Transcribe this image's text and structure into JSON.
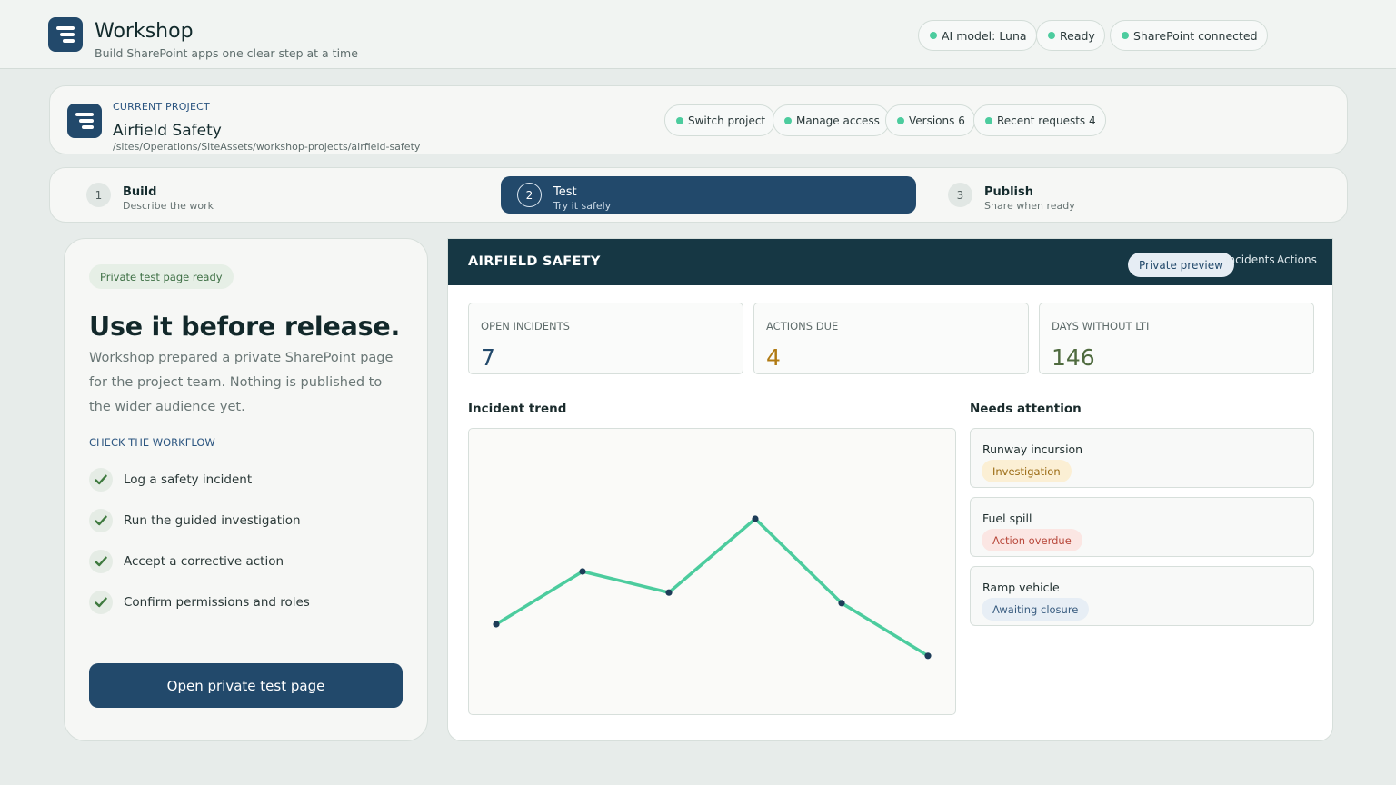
{
  "header": {
    "app_title": "Workshop",
    "app_subtitle": "Build SharePoint apps one clear step at a time",
    "status": [
      {
        "label": "AI model: Luna"
      },
      {
        "label": "Ready"
      },
      {
        "label": "SharePoint connected"
      }
    ]
  },
  "project": {
    "label": "CURRENT PROJECT",
    "name": "Airfield Safety",
    "path": "/sites/Operations/SiteAssets/workshop-projects/airfield-safety",
    "actions": [
      {
        "label": "Switch project"
      },
      {
        "label": "Manage access"
      },
      {
        "label": "Versions 6"
      },
      {
        "label": "Recent requests 4"
      }
    ]
  },
  "steps": [
    {
      "number": "1",
      "title": "Build",
      "desc": "Describe the work"
    },
    {
      "number": "2",
      "title": "Test",
      "desc": "Try it safely"
    },
    {
      "number": "3",
      "title": "Publish",
      "desc": "Share when ready"
    }
  ],
  "test_panel": {
    "badge": "Private test page ready",
    "headline": "Use it before release.",
    "description": "Workshop prepared a private SharePoint page for the project team. Nothing is published to the wider audience yet.",
    "checklist_label": "CHECK THE WORKFLOW",
    "checklist": [
      "Log a safety incident",
      "Run the guided investigation",
      "Accept a corrective action",
      "Confirm permissions and roles"
    ],
    "open_button": "Open private test page"
  },
  "preview": {
    "title": "AIRFIELD SAFETY",
    "badge": "Private preview",
    "tabs": [
      "Incidents",
      "Actions"
    ],
    "kpis": [
      {
        "label": "OPEN INCIDENTS",
        "value": "7",
        "color": "#22496b"
      },
      {
        "label": "ACTIONS DUE",
        "value": "4",
        "color": "#b07a12"
      },
      {
        "label": "DAYS WITHOUT LTI",
        "value": "146",
        "color": "#4f6b3f"
      }
    ],
    "trend_label": "Incident trend",
    "attention_label": "Needs attention",
    "attention": [
      {
        "title": "Runway incursion",
        "tag": "Investigation",
        "tag_bg": "#fbefd4",
        "tag_color": "#9a6a12"
      },
      {
        "title": "Fuel spill",
        "tag": "Action overdue",
        "tag_bg": "#fbe6e3",
        "tag_color": "#b8483b"
      },
      {
        "title": "Ramp vehicle",
        "tag": "Awaiting closure",
        "tag_bg": "#e7eef5",
        "tag_color": "#3a5d80"
      }
    ]
  },
  "chart_data": {
    "type": "line",
    "x": [
      1,
      2,
      3,
      4,
      5,
      6
    ],
    "series": [
      {
        "values": [
          3.0,
          5.0,
          4.2,
          7.0,
          3.8,
          1.8
        ]
      }
    ],
    "ylim": [
      0,
      10
    ],
    "grid": false,
    "line_color": "#4ccc9e",
    "point_color": "#1d3c58"
  }
}
